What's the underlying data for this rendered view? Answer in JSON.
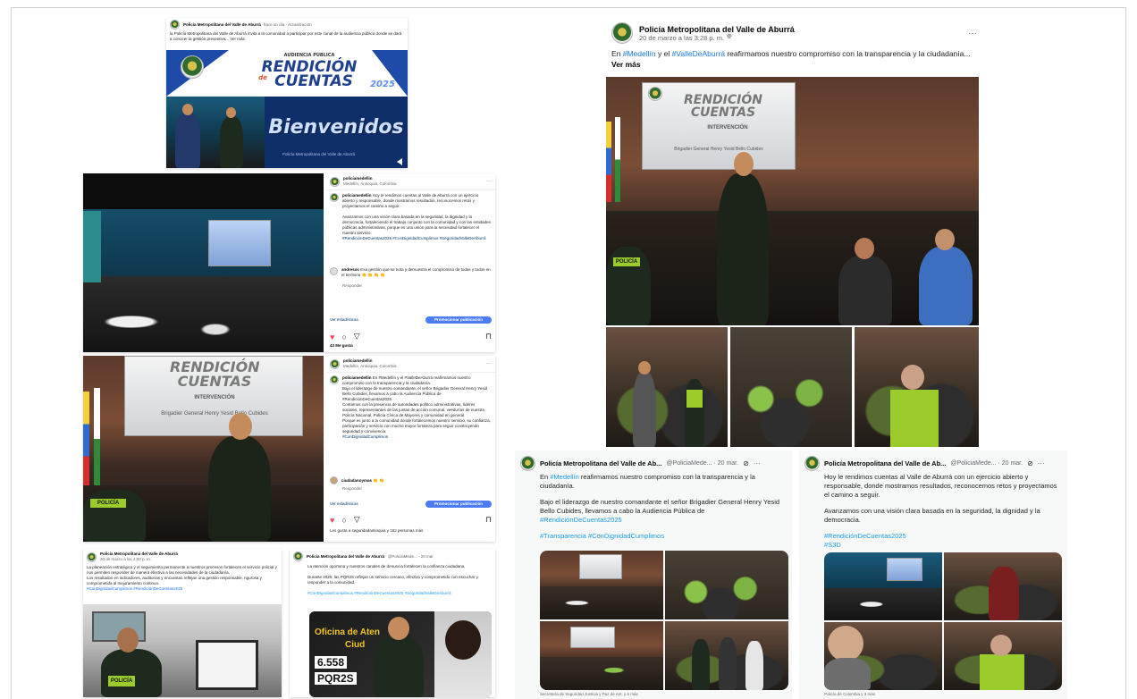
{
  "fb_top": {
    "author": "Policía Metropolitana del Valle de Aburrá",
    "meta": "hace un día · Actualización",
    "text": "la Policía Metropolitana del Valle de Aburrá invita a la comunidad a participar por este canal de la audiencia pública donde se dará a conocer la gestión preventiva... Ver más",
    "banner_sub": "AUDIENCIA PÚBLICA",
    "banner_title_1": "RENDICIÓN",
    "banner_title_2": "CUENTAS",
    "banner_de": "de",
    "banner_year": "2025",
    "welcome": "Bienvenidos",
    "caption": "Policía Metropolitana del Valle de Aburrá"
  },
  "fb_main": {
    "author": "Policía Metropolitana del Valle de Aburrá",
    "date": "20 de marzo a las 3:28 p. m.",
    "text_pre": "En ",
    "hashtag_1": "#Medellín",
    "text_mid": " y el ",
    "hashtag_2": "#ValleDeAburrá",
    "text_post": " reafirmamos nuestro compromiso con la transparencia y la ciudadanía...",
    "see_more": "Ver más",
    "more": "···",
    "screen_title_1": "RENDICIÓN",
    "screen_title_2": "CUENTAS",
    "screen_sub": "INTERVENCIÓN",
    "screen_name": "Brigadier General Henry Yesid Bello Cubides",
    "vest_label": "POLICÍA"
  },
  "ig_1": {
    "user": "policiamedellin",
    "location": "Medellín, Antioquia, Colombia",
    "caption_user": "policiamedellin",
    "caption": "Hoy le rendimos cuentas al Valle de Aburrá con un ejercicio abierto y responsable, donde mostramos resultados, reconocemos retos y proyectamos el camino a seguir.",
    "caption_2": "Avanzamos con una visión clara basada en la seguridad, la dignidad y la democracia, fortaleciendo el trabajo conjunto con la comunidad y con las entidades públicas administrativas, porque es una unión para la necesidad fortalecer el nuestro servicio.",
    "tags": "#RendiciónDeCuentas2025 #ConDignidadCumplimos #SeguridadValleDeAburrá",
    "comment_user": "andresoc",
    "comment": "Esa gestión que se nota y demuestra el compromiso de todas y todos en el territorio 👏 👏 👏 👏",
    "reply": "Responder",
    "insights": "Ver estadísticas",
    "promote": "Promocionar publicación",
    "likes": "43 Me gusta"
  },
  "ig_2": {
    "user": "policiamedellin",
    "location": "Medellín, Antioquia, Colombia",
    "caption_user": "policiamedellin",
    "caption": "En #Medellín y el #ValleDeAburrá reafirmamos nuestro compromiso con la transparencia y la ciudadanía.",
    "caption_2": "Bajo el liderazgo de nuestro comandante, el señor Brigadier General Henry Yesid Bello Cubides, llevamos a cabo la Audiencia Pública de #RendiciónDeCuentas2025.",
    "caption_3": "Contamos con la presencia de autoridades político administrativas, líderes sociales, representantes de las juntas de acción comunal, veedurías de nuestra Policía Nacional, Policía Cívica de Mayores y comunidad en general.",
    "caption_4": "Porque es junto a la comunidad donde fortalecemos nuestro servicio, su confianza, participación y servicio con mucho mayor fortaleza para seguir construyendo seguridad y convivencia.",
    "tags": "#ConDignidadCumplimos",
    "comment_user": "ciudadanoymas",
    "comment": "👏 👏",
    "reply": "Responder",
    "insights": "Ver estadísticas",
    "promote": "Promocionar publicación",
    "likes": "Les gusta a seguridadantioquia y 162 personas más",
    "screen_title": "RENDICIÓN",
    "screen_title_2": "CUENTAS",
    "screen_sub": "INTERVENCIÓN",
    "screen_name": "Brigadier General Henry Yesid Bello Cubides",
    "vest_label": "POLICÍA"
  },
  "fb_bottom_left": {
    "author": "Policía Metropolitana del Valle de Aburrá",
    "meta": "20 de marzo a las 4:00 p. m.",
    "text": "La planeación estratégica y el seguimiento permanente a nuestros procesos fortalecen el servicio policial y nos permiten responder de manera efectiva a las necesidades de la ciudadanía.",
    "text_2": "Los resultados en indicadores, auditorías y encuestas reflejan una gestión responsable, rigurosa y comprometida al mejoramiento continuo.",
    "tags": "#ConDignidadCumplimos #RendiciónDeCuentas2025",
    "vest_label": "POLICÍA"
  },
  "tw_bottom_mid": {
    "author": "Policía Metropolitana del Valle de Aburrá",
    "handle": "@PoliciaMede... · 20 mar.",
    "text": "La atención oportuna y nuestros canales de denuncia fortalecen la confianza ciudadana.",
    "text_2": "Durante 2025, las PQR2S reflejan un servicio cercano, efectivo y comprometido con escuchar y responder a la comunidad.",
    "tags": "#ConDignidadCumplimos #RendiciónDeCuentas2025 #SeguridadValleDeAburrá",
    "poster_line": "Oficina de Aten",
    "poster_line_2": "Ciud",
    "poster_number": "6.558",
    "poster_label": "PQR2S"
  },
  "tw_1": {
    "author": "Policía Metropolitana del Valle de Ab...",
    "handle": "@PoliciaMede... · 20 mar.",
    "text_pre": "En ",
    "hashtag": "#Medellín",
    "text": " reafirmamos nuestro compromiso con la transparencia y la ciudadanía.",
    "text_2_pre": "Bajo el liderazgo de nuestro comandante el señor Brigadier General Henry Yesid Bello Cubides, llevamos a cabo la Audiencia Pública de ",
    "text_2_tag": "#RendiciónDeCuentas2025",
    "tags": "#Transparencia #ConDignidadCumplimos",
    "footer": "Secretaría de Seguridad Justicia y Paz de Ant. y 6 más"
  },
  "tw_2": {
    "author": "Policía Metropolitana del Valle de Ab...",
    "handle": "@PoliciaMede... · 20 mar.",
    "text": "Hoy le rendimos cuentas al Valle de Aburrá con un ejercicio abierto y responsable, donde mostramos resultados, reconocemos retos y proyectamos el camino a seguir.",
    "text_2": "Avanzamos con una visión clara basada en la seguridad, la dignidad y la democracia.",
    "tags": "#RendiciónDeCuentas2025 #S3D",
    "footer": "Policía de Colombia y 3 más"
  },
  "colors": {
    "fb_blue": "#1877f2",
    "tw_blue": "#1d9bf0",
    "police_green": "#2f6b2f",
    "vest_green": "#9ccc2c",
    "banner_blue": "#1f3f8f"
  },
  "icons": [
    "globe-icon",
    "more-icon",
    "heart-icon",
    "comment-icon",
    "share-icon",
    "bookmark-icon",
    "grok-icon"
  ]
}
